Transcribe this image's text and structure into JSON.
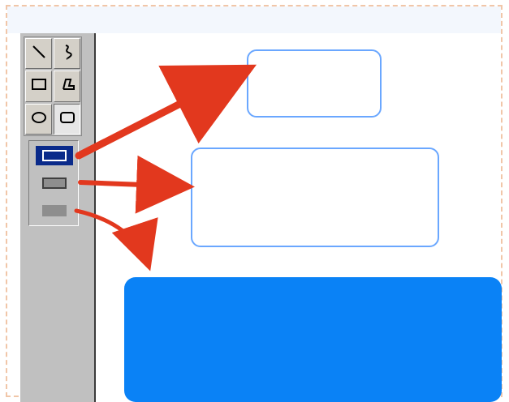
{
  "toolbar": {
    "tools": [
      {
        "icon": "line-icon"
      },
      {
        "icon": "curve-icon"
      },
      {
        "icon": "rectangle-icon"
      },
      {
        "icon": "polygon-icon"
      },
      {
        "icon": "ellipse-icon"
      },
      {
        "icon": "rounded-rectangle-icon"
      }
    ],
    "selected_tool": "rounded-rectangle-icon",
    "fill_options": [
      {
        "icon": "outline-only-icon",
        "selected": true
      },
      {
        "icon": "outline-and-fill-icon",
        "selected": false
      },
      {
        "icon": "fill-only-icon",
        "selected": false
      }
    ]
  },
  "colors": {
    "toolbar_bg": "#c0c0c0",
    "selected_option_bg": "#0a2a8a",
    "outline_color": "#6aa7ff",
    "fill_color": "#0a82f6",
    "arrow_color": "#e2381e"
  }
}
